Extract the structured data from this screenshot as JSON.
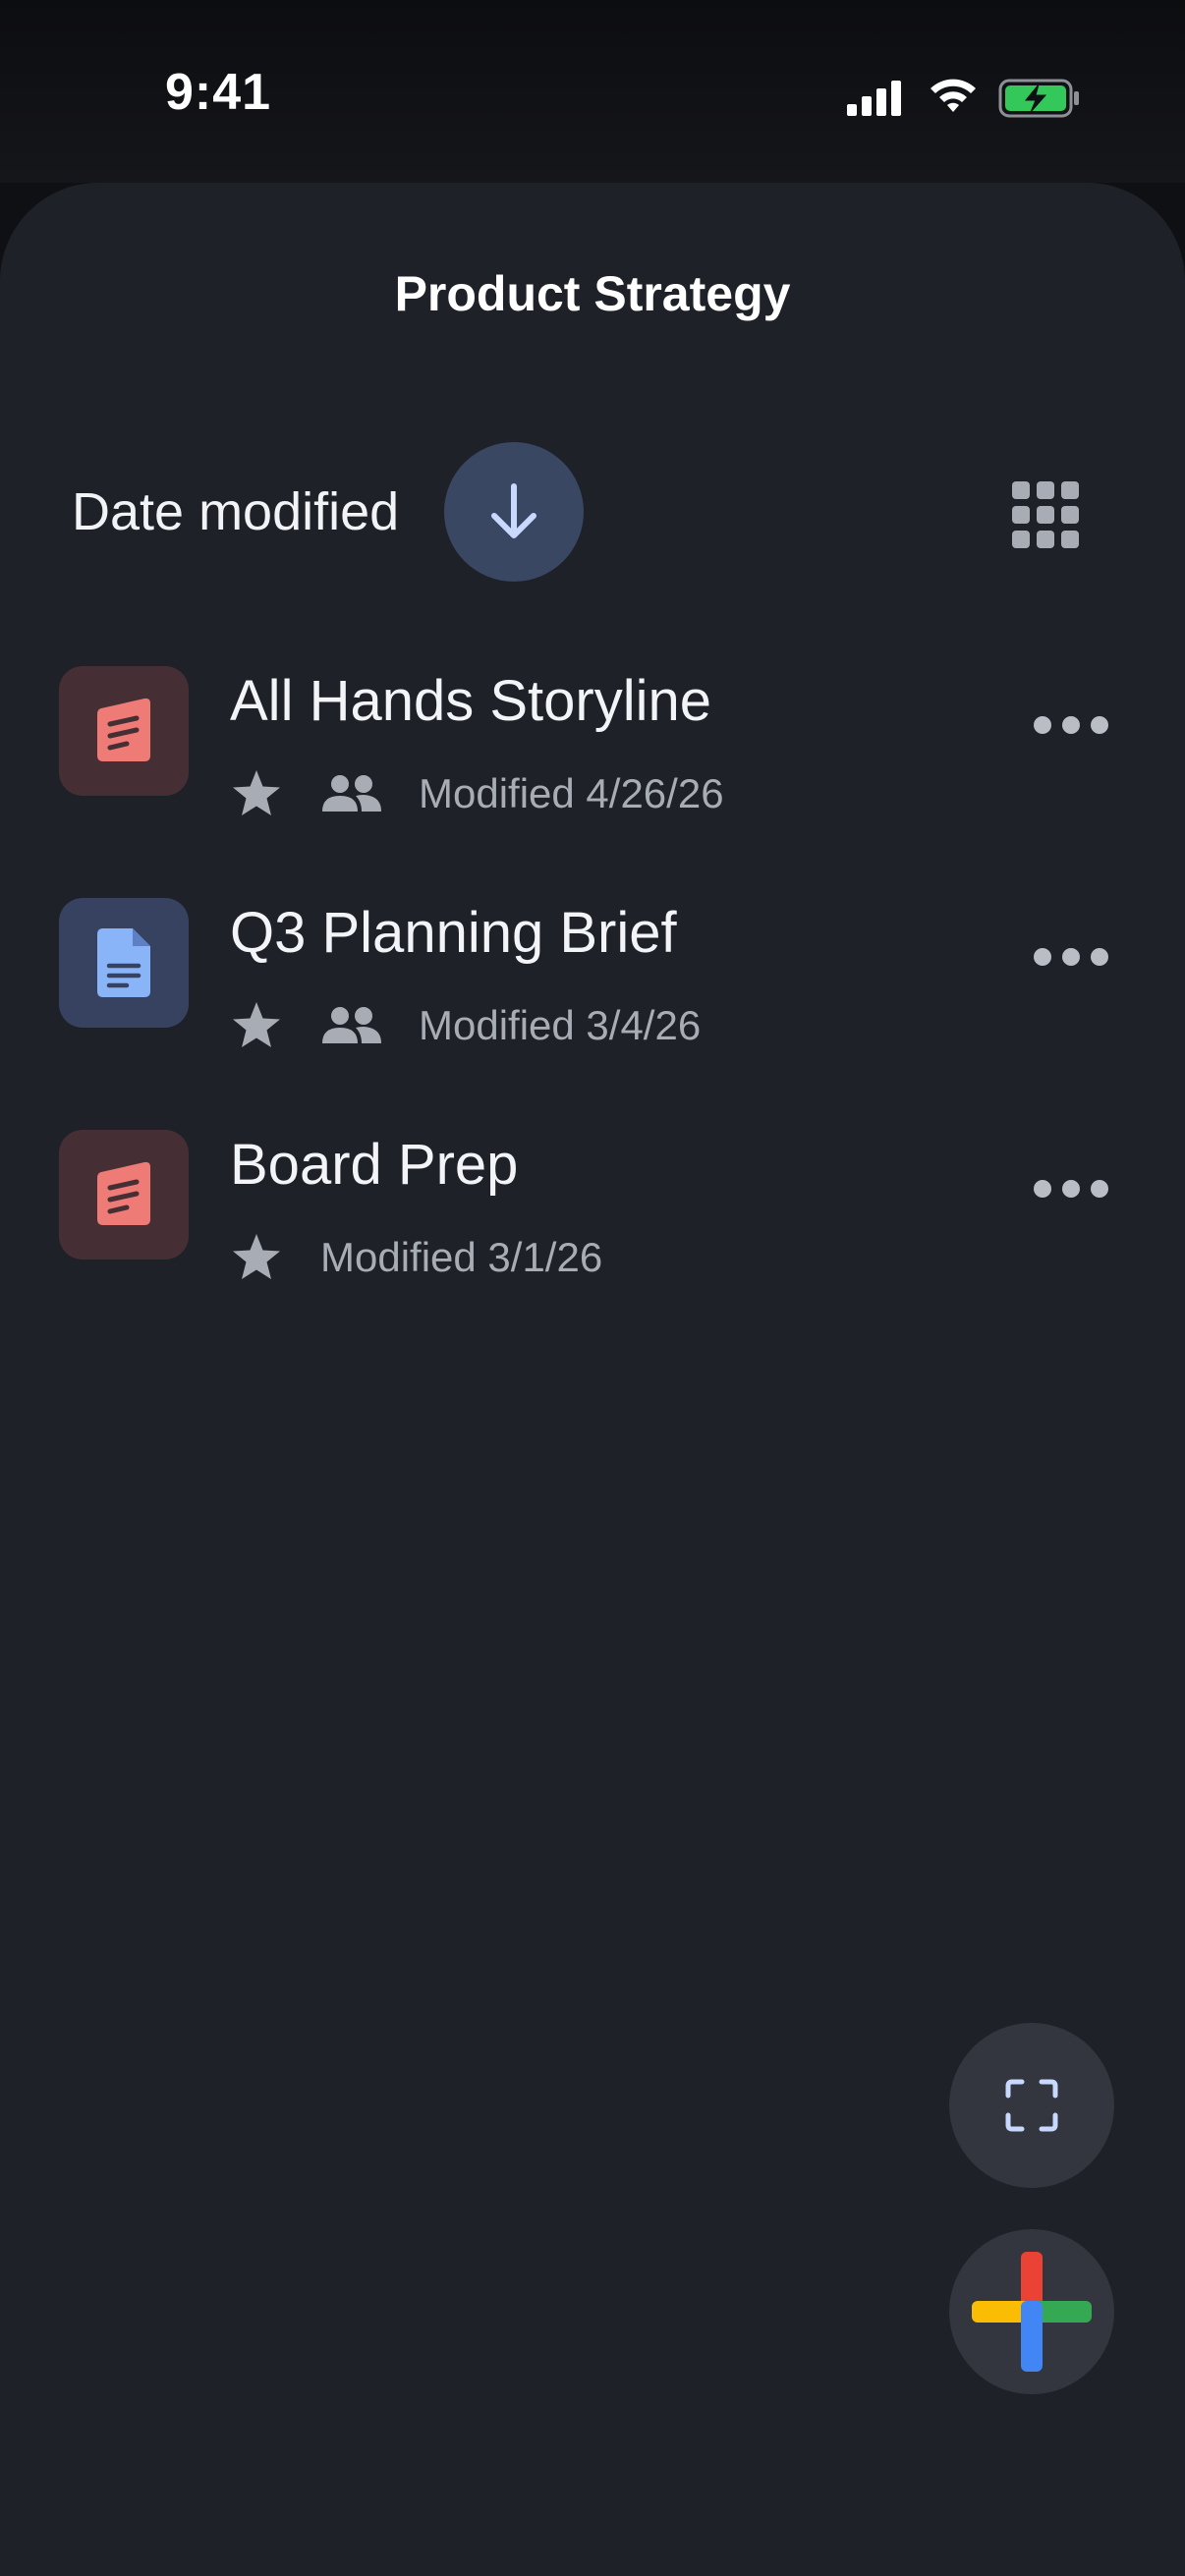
{
  "status_bar": {
    "time": "9:41",
    "icons": [
      "cellular-signal-icon",
      "wifi-icon",
      "battery-charging-icon"
    ],
    "battery_color": "#34c759"
  },
  "header": {
    "title": "Product Strategy"
  },
  "sort": {
    "label": "Date modified",
    "direction_icon": "arrow-down-icon",
    "view_toggle_icon": "grid-view-icon"
  },
  "files": [
    {
      "name": "All Hands Storyline",
      "type": "slides",
      "thumb_icon": "slides-file-icon",
      "starred": true,
      "shared": true,
      "modified": "Modified 4/26/26"
    },
    {
      "name": "Q3 Planning Brief",
      "type": "doc",
      "thumb_icon": "doc-file-icon",
      "starred": true,
      "shared": true,
      "modified": "Modified 3/4/26"
    },
    {
      "name": "Board Prep",
      "type": "slides",
      "thumb_icon": "slides-file-icon",
      "starred": true,
      "shared": false,
      "modified": "Modified 3/1/26"
    }
  ],
  "fabs": {
    "scan_icon": "scan-icon",
    "new_icon": "plus-icon"
  },
  "colors": {
    "background": "#1f2128",
    "slides_accent": "#ee7b76",
    "doc_accent": "#8ab4f8",
    "plus_red": "#ea4335",
    "plus_blue": "#4285f4",
    "plus_yellow": "#fbbc04",
    "plus_green": "#34a853"
  }
}
